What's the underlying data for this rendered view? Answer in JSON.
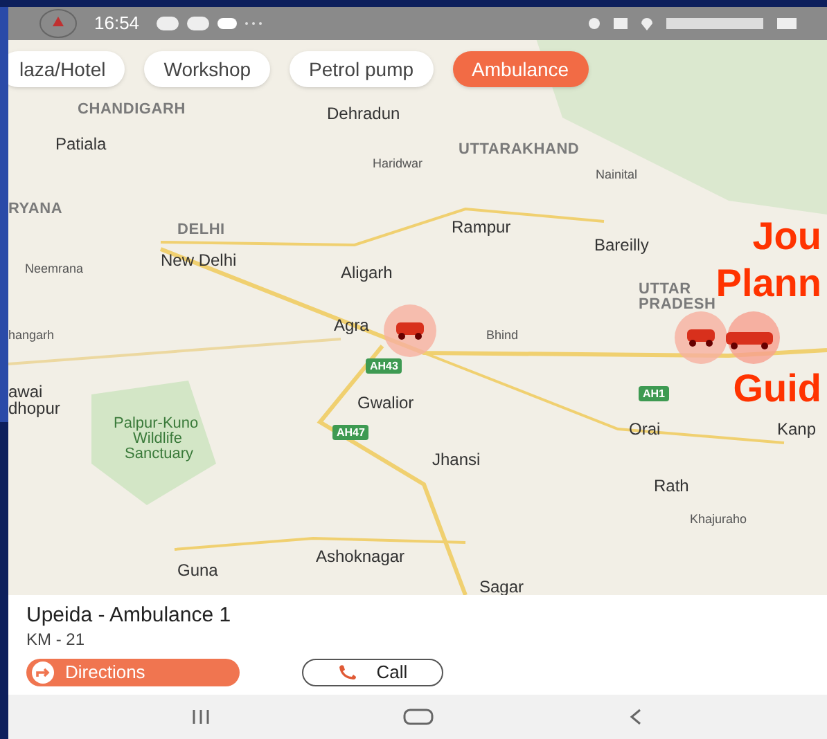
{
  "status_bar": {
    "time": "16:54"
  },
  "filter_chips": [
    {
      "label": "laza/Hotel",
      "selected": false
    },
    {
      "label": "Workshop",
      "selected": false
    },
    {
      "label": "Petrol pump",
      "selected": false
    },
    {
      "label": "Ambulance",
      "selected": true
    }
  ],
  "map": {
    "labels": [
      {
        "text": "CHANDIGARH",
        "kind": "region"
      },
      {
        "text": "Dehradun",
        "kind": "city"
      },
      {
        "text": "Patiala",
        "kind": "city"
      },
      {
        "text": "UTTARAKHAND",
        "kind": "region"
      },
      {
        "text": "Haridwar",
        "kind": "town"
      },
      {
        "text": "Nainital",
        "kind": "town"
      },
      {
        "text": "RYANA",
        "kind": "region"
      },
      {
        "text": "DELHI",
        "kind": "region"
      },
      {
        "text": "Rampur",
        "kind": "city"
      },
      {
        "text": "New Delhi",
        "kind": "city"
      },
      {
        "text": "Bareilly",
        "kind": "city"
      },
      {
        "text": "Neemrana",
        "kind": "town"
      },
      {
        "text": "Aligarh",
        "kind": "city"
      },
      {
        "text": "UTTAR",
        "kind": "region"
      },
      {
        "text": "PRADESH",
        "kind": "region"
      },
      {
        "text": "hangarh",
        "kind": "town"
      },
      {
        "text": "Agra",
        "kind": "city"
      },
      {
        "text": "Bhind",
        "kind": "town"
      },
      {
        "text": "awai",
        "kind": "city"
      },
      {
        "text": "dhopur",
        "kind": "city"
      },
      {
        "text": "Gwalior",
        "kind": "city"
      },
      {
        "text": "Palpur-Kuno",
        "kind": "park"
      },
      {
        "text": "Orai",
        "kind": "city"
      },
      {
        "text": "Kanp",
        "kind": "city"
      },
      {
        "text": "Wildlife",
        "kind": "park"
      },
      {
        "text": "Sanctuary",
        "kind": "park"
      },
      {
        "text": "Jhansi",
        "kind": "city"
      },
      {
        "text": "Rath",
        "kind": "city"
      },
      {
        "text": "Khajuraho",
        "kind": "town"
      },
      {
        "text": "Ashoknagar",
        "kind": "city"
      },
      {
        "text": "Guna",
        "kind": "city"
      },
      {
        "text": "Sagar",
        "kind": "city"
      }
    ],
    "highway_shields": [
      "AH43",
      "AH47",
      "AH1"
    ]
  },
  "slide_overlay": [
    "Jou",
    "Plann",
    "Guid"
  ],
  "detail_card": {
    "title": "Upeida - Ambulance 1",
    "distance": "KM - 21",
    "buttons": [
      {
        "label": "Directions",
        "kind": "primary"
      },
      {
        "label": "Call",
        "kind": "outline"
      }
    ]
  },
  "nav_bar": {
    "buttons": [
      {
        "kind": "recents"
      },
      {
        "kind": "home"
      },
      {
        "kind": "back"
      }
    ]
  }
}
